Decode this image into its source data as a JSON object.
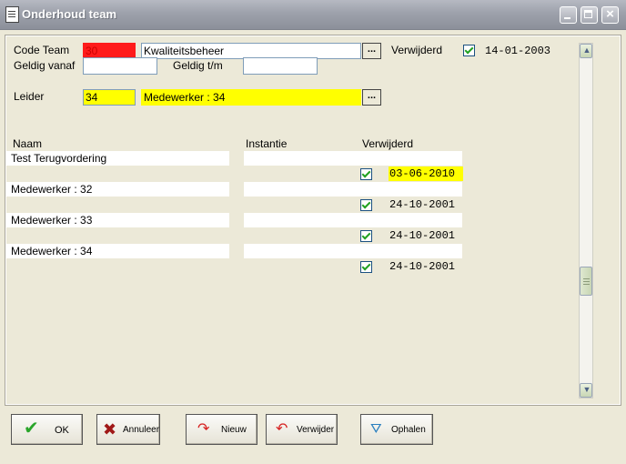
{
  "window": {
    "title": "Onderhoud team"
  },
  "form": {
    "code_team_label": "Code Team",
    "code_team_value": "30",
    "team_name_value": "Kwaliteitsbeheer",
    "verwijderd_label": "Verwijderd",
    "verwijderd_date": "14-01-2003",
    "geldig_vanaf_label": "Geldig vanaf",
    "geldig_vanaf_value": "",
    "geldig_tm_label": "Geldig t/m",
    "geldig_tm_value": "",
    "leider_label": "Leider",
    "leider_code": "34",
    "leider_name": "Medewerker : 34",
    "ellipsis": "..."
  },
  "table": {
    "col_naam": "Naam",
    "col_instantie": "Instantie",
    "col_verwijderd": "Verwijderd",
    "rows": [
      {
        "naam": "Test Terugvordering",
        "instantie": "",
        "date": "03-06-2010",
        "highlight": true
      },
      {
        "naam": "Medewerker : 32",
        "instantie": "",
        "date": "24-10-2001",
        "highlight": false
      },
      {
        "naam": "Medewerker : 33",
        "instantie": "",
        "date": "24-10-2001",
        "highlight": false
      },
      {
        "naam": "Medewerker : 34",
        "instantie": "",
        "date": "24-10-2001",
        "highlight": false
      }
    ]
  },
  "buttons": {
    "ok": "OK",
    "annuleer": "Annuleer",
    "nieuw": "Nieuw",
    "verwijder": "Verwijder",
    "ophalen": "Ophalen"
  },
  "colors": {
    "required_red": "#ff1b1b",
    "highlight_yellow": "#ffff00",
    "check_green": "#21a121"
  },
  "icons": {
    "ok": "checkmark-icon",
    "annuleer": "cross-icon",
    "nieuw": "curved-arrow-right-icon",
    "verwijder": "curved-arrow-left-icon",
    "ophalen": "fetch-icon"
  }
}
